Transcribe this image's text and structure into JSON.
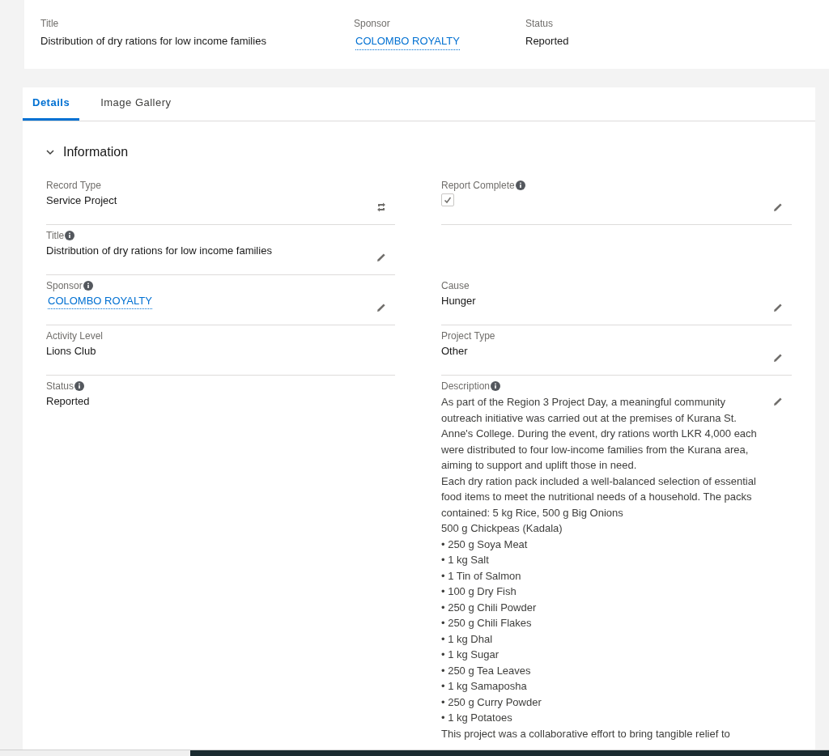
{
  "header": {
    "fields": [
      {
        "label": "Title",
        "value": "Distribution of dry rations for low income families",
        "kind": "text"
      },
      {
        "label": "Sponsor",
        "value": "COLOMBO ROYALTY",
        "kind": "link"
      },
      {
        "label": "Status",
        "value": "Reported",
        "kind": "text"
      }
    ]
  },
  "tabs": [
    {
      "label": "Details",
      "selected": true
    },
    {
      "label": "Image Gallery",
      "selected": false
    }
  ],
  "section": {
    "title": "Information",
    "expanded": true
  },
  "rows": [
    {
      "left": {
        "label": "Record Type",
        "info": false,
        "kind": "text",
        "value": "Service Project",
        "action": {
          "kind": "change"
        }
      },
      "right": {
        "label": "Report Complete",
        "info": true,
        "kind": "checkbox",
        "checked": true,
        "action": {
          "kind": "edit"
        }
      }
    },
    {
      "left": {
        "label": "Title",
        "info": true,
        "kind": "text",
        "value": "Distribution of dry rations for low income families",
        "action": {
          "kind": "edit"
        }
      }
    },
    {
      "left": {
        "label": "Sponsor",
        "info": true,
        "kind": "link",
        "value": "COLOMBO ROYALTY",
        "action": {
          "kind": "edit"
        }
      },
      "right": {
        "label": "Cause",
        "info": false,
        "kind": "text",
        "value": "Hunger",
        "action": {
          "kind": "edit"
        }
      }
    },
    {
      "left": {
        "label": "Activity Level",
        "info": false,
        "kind": "text",
        "value": "Lions Club"
      },
      "right": {
        "label": "Project Type",
        "info": false,
        "kind": "text",
        "value": "Other",
        "action": {
          "kind": "edit"
        }
      }
    },
    {
      "left": {
        "label": "Status",
        "info": true,
        "kind": "text",
        "value": "Reported"
      },
      "right": {
        "label": "Description",
        "info": true,
        "kind": "longtext",
        "action": {
          "kind": "edit"
        },
        "lines": [
          "As part of the Region 3 Project Day, a meaningful community outreach initiative was carried out at the premises of Kurana St. Anne's College. During the event, dry rations worth LKR 4,000 each were distributed to four low-income families from the Kurana area, aiming to support and uplift those in need.",
          "Each dry ration pack included a well-balanced selection of essential food items to meet the nutritional needs of a household. The packs contained: 5 kg Rice, 500 g Big Onions",
          "500 g Chickpeas (Kadala)",
          "• 250 g Soya Meat",
          "• 1 kg Salt",
          "• 1 Tin of Salmon",
          "• 100 g Dry Fish",
          "• 250 g Chili Powder",
          "• 250 g Chili Flakes",
          "• 1 kg Dhal",
          "• 1 kg Sugar",
          "• 250 g Tea Leaves",
          "• 1 kg Samaposha",
          "• 250 g Curry Powder",
          "• 1 kg Potatoes",
          "This project was a collaborative effort to bring tangible relief to"
        ]
      }
    }
  ]
}
